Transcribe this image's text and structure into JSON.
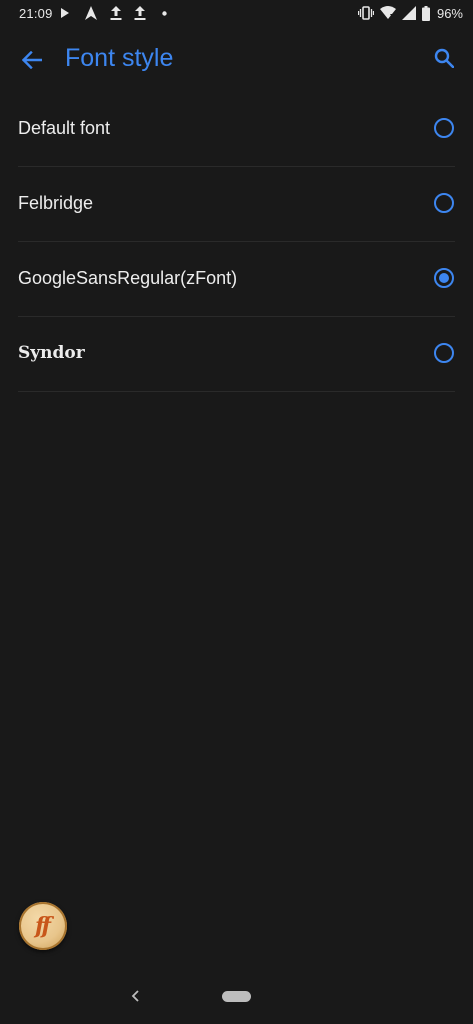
{
  "status_bar": {
    "time": "21:09",
    "battery_percent": "96%",
    "left_icons": [
      "play-icon",
      "navigation-arrow-icon",
      "upload-icon",
      "upload-icon",
      "dot-icon"
    ],
    "right_icons": [
      "vibrate-icon",
      "wifi-icon",
      "signal-icon",
      "battery-icon"
    ]
  },
  "app_bar": {
    "title": "Font style",
    "back_icon": "arrow-back-icon",
    "search_icon": "search-icon"
  },
  "font_options": [
    {
      "label": "Default font",
      "selected": false
    },
    {
      "label": "Felbridge",
      "selected": false
    },
    {
      "label": "GoogleSansRegular(zFont)",
      "selected": true
    },
    {
      "label": "Syndor",
      "selected": false
    }
  ],
  "floating_logo": {
    "text": "ff"
  },
  "colors": {
    "accent": "#3d86f0",
    "background": "#191919",
    "text": "#ededed",
    "divider": "#2a2a2a"
  }
}
